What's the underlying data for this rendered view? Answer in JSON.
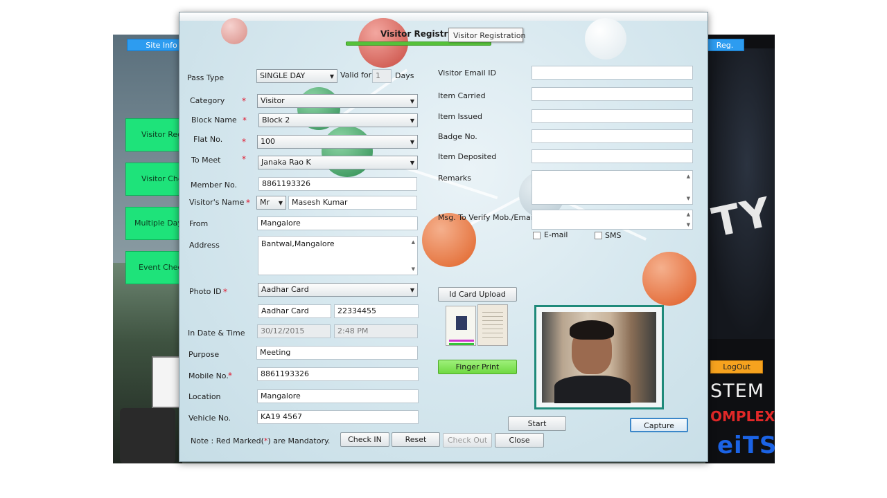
{
  "background": {
    "top_buttons": {
      "site_info": "Site Info",
      "reg": "Reg."
    },
    "side_buttons": [
      "Visitor Reg",
      "Visitor Che",
      "Multiple Day",
      "Event Check"
    ],
    "logout": "LogOut",
    "text_system": "STEM",
    "text_complex": "OMPLEX",
    "text_its": "eiTS",
    "shirt_text": "TY"
  },
  "dialog": {
    "title": "Visitor Registration",
    "tooltip": "Visitor Registration",
    "left": {
      "pass_type": {
        "label": "Pass Type",
        "value": "SINGLE DAY",
        "valid_for_label": "Valid for",
        "valid_for_value": "1",
        "days_label": "Days"
      },
      "category": {
        "label": "Category",
        "value": "Visitor"
      },
      "block_name": {
        "label": "Block Name",
        "value": "Block 2"
      },
      "flat_no": {
        "label": "Flat No.",
        "value": "100"
      },
      "to_meet": {
        "label": "To Meet",
        "value": "Janaka Rao K"
      },
      "member_no": {
        "label": "Member No.",
        "value": "8861193326"
      },
      "visitor_name": {
        "label": "Visitor's Name",
        "salutation": "Mr",
        "value": "Masesh Kumar"
      },
      "from": {
        "label": "From",
        "value": "Mangalore"
      },
      "address": {
        "label": "Address",
        "value": "Bantwal,Mangalore"
      },
      "photo_id": {
        "label": "Photo ID",
        "value": "Aadhar Card",
        "id_type": "Aadhar Card",
        "id_number": "22334455"
      },
      "in_date_time": {
        "label": "In Date & Time",
        "date": "30/12/2015",
        "time": "2:48 PM"
      },
      "purpose": {
        "label": "Purpose",
        "value": "Meeting"
      },
      "mobile_no": {
        "label": "Mobile No.",
        "value": "8861193326"
      },
      "location": {
        "label": "Location",
        "value": "Mangalore"
      },
      "vehicle_no": {
        "label": "Vehicle No.",
        "value": "KA19 4567"
      }
    },
    "right": {
      "visitor_email": {
        "label": "Visitor Email ID",
        "value": ""
      },
      "item_carried": {
        "label": "Item Carried",
        "value": ""
      },
      "item_issued": {
        "label": "Item Issued",
        "value": ""
      },
      "badge_no": {
        "label": "Badge No.",
        "value": ""
      },
      "item_deposited": {
        "label": "Item Deposited",
        "value": ""
      },
      "remarks": {
        "label": "Remarks",
        "value": ""
      },
      "msg_verify": {
        "label": "Msg. To Verify Mob./Email",
        "value": ""
      },
      "email_check": "E-mail",
      "sms_check": "SMS",
      "id_card_upload": "Id Card Upload",
      "finger_print": "Finger Print",
      "start": "Start",
      "capture": "Capture"
    },
    "note": {
      "prefix": "Note : Red Marked(",
      "star": "*",
      "suffix": ") are Mandatory."
    },
    "buttons": {
      "check_in": "Check IN",
      "reset": "Reset",
      "check_out": "Check Out",
      "close": "Close"
    }
  },
  "colors": {
    "accent_green": "#56c13a",
    "required_red": "#e0162c",
    "webcam_border": "#1f8a7a"
  }
}
